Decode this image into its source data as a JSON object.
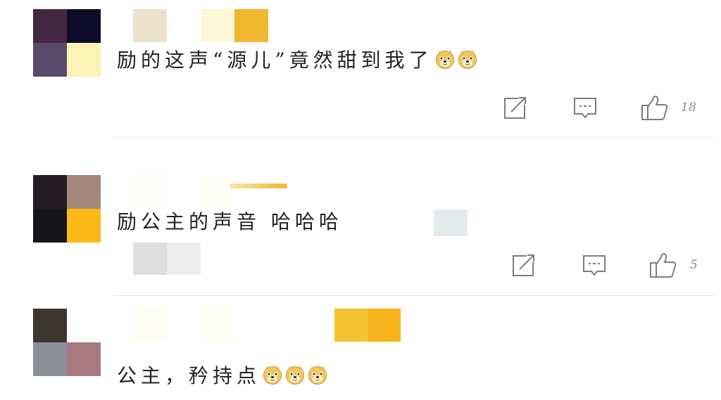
{
  "comments": [
    {
      "text": "励的这声“源儿”竟然甜到我了",
      "emoji_count": 2,
      "like_count": "18",
      "avatar_colors": [
        "#442744",
        "#0e0b2b",
        "#5a4a6a",
        "#fdf3b4"
      ],
      "nick_colors": [
        "#ece2cc",
        "#ffffff",
        "#fdf7d7",
        "#f2b731"
      ]
    },
    {
      "text": "励公主的声音 哈哈哈",
      "emoji_count": 0,
      "like_count": "5",
      "avatar_colors": [
        "#231c21",
        "#a2877a",
        "#15151a",
        "#fbb919"
      ],
      "nick_colors": [
        "#fcfcf8",
        "#ffffff",
        "#fffff7",
        "#ffffff"
      ]
    },
    {
      "text": "公主，矜持点",
      "emoji_count": 3,
      "like_count": "",
      "avatar_colors": [
        "#3e352f",
        "#ffffff",
        "#8d909a",
        "#a87a80"
      ],
      "nick_colors": [
        "#fdfdf5",
        "#ffffff",
        "#fffff8",
        "#ffffff"
      ]
    }
  ],
  "icons": {
    "share": "share-icon",
    "comment": "comment-icon",
    "like": "thumbs-up-icon",
    "emoji": "doge-emoji-icon"
  },
  "colors": {
    "icon_stroke": "#7d7d7d",
    "text": "#222222",
    "divider": "#e6e6e6"
  }
}
